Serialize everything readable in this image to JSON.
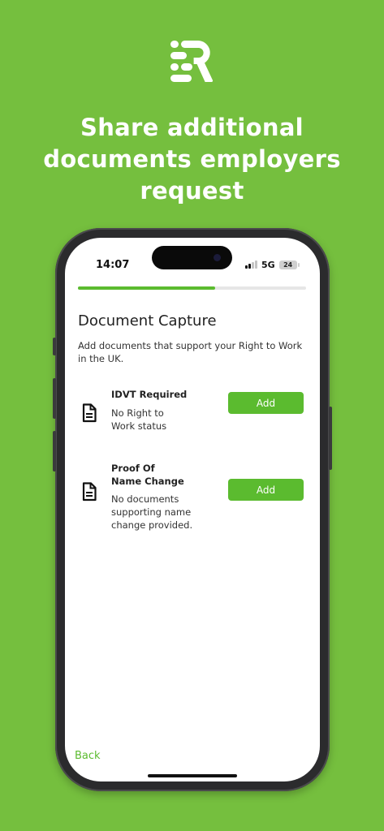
{
  "headline": {
    "line1": "Share additional",
    "line2": "documents employers",
    "line3": "request"
  },
  "status_bar": {
    "time": "14:07",
    "network": "5G",
    "battery": "24"
  },
  "onboarding_progress": 0.6,
  "screen": {
    "title": "Document Capture",
    "subtitle": "Add documents that support your Right to Work in the UK.",
    "documents": [
      {
        "name_line1": "IDVT Required",
        "name_line2": "",
        "desc_line1": "No Right to",
        "desc_line2": "Work status",
        "desc_line3": "",
        "button": "Add",
        "icon": "document-icon"
      },
      {
        "name_line1": "Proof Of",
        "name_line2": "Name Change",
        "desc_line1": "No documents",
        "desc_line2": "supporting name",
        "desc_line3": "change provided.",
        "button": "Add",
        "icon": "document-icon"
      }
    ],
    "back_label": "Back"
  },
  "colors": {
    "background": "#75bf3e",
    "accent": "#5bbb2f",
    "text": "#222222"
  }
}
